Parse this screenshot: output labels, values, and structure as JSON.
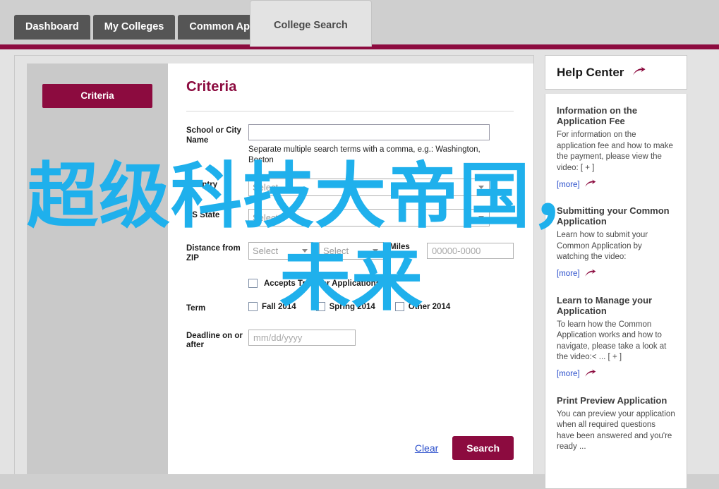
{
  "tabs": [
    {
      "label": "Dashboard",
      "active": false
    },
    {
      "label": "My Colleges",
      "active": false
    },
    {
      "label": "Common App",
      "active": false
    },
    {
      "label": "College Search",
      "active": true
    }
  ],
  "sidebar": {
    "criteria_button": "Criteria"
  },
  "form": {
    "title": "Criteria",
    "school_or_city": {
      "label": "School or City Name",
      "value": "",
      "placeholder": "",
      "hint": "Separate multiple search terms with a comma, e.g.: Washington, Boston"
    },
    "country": {
      "label": "Country",
      "value": "Select"
    },
    "us_state": {
      "label": "US State",
      "value": "Select"
    },
    "distance_from_zip": {
      "label": "Distance from ZIP",
      "distance_value": "Select",
      "unit_value": "Select",
      "miles_from_text": "Miles from",
      "zip_placeholder": "00000-0000",
      "zip_value": ""
    },
    "accepts_transfer": {
      "label": "Accepts Transfer Applications",
      "checked": false
    },
    "term": {
      "label": "Term",
      "options": [
        {
          "label": "Fall 2014",
          "checked": false
        },
        {
          "label": "Spring 2014",
          "checked": false
        },
        {
          "label": "Other 2014",
          "checked": false
        }
      ]
    },
    "deadline": {
      "label": "Deadline on or after",
      "placeholder": "mm/dd/yyyy",
      "value": ""
    },
    "clear_label": "Clear",
    "search_label": "Search"
  },
  "help": {
    "title": "Help Center",
    "more_label": "[more]",
    "items": [
      {
        "title": "Information on the Application Fee",
        "body": "For information on the application fee and how to make the payment, please view the video: [ + ]"
      },
      {
        "title": "Submitting your Common Application",
        "body": "Learn how to submit your Common Application by watching the video:"
      },
      {
        "title": "Learn to Manage your Application",
        "body": "To learn how the Common Application works and how to navigate, please take a look at the video:< ... [ + ]"
      },
      {
        "title": "Print Preview Application",
        "body": "You can preview your application when all required questions have been answered and you're ready ..."
      }
    ]
  },
  "watermark": {
    "line1": "超级科技大帝国，",
    "line2": "未来",
    "color": "#1fb0ec"
  },
  "colors": {
    "accent": "#8c0b3f",
    "tab_inactive": "#555555",
    "tab_active_bg": "#e3e3e3",
    "link": "#2a4ecb"
  }
}
